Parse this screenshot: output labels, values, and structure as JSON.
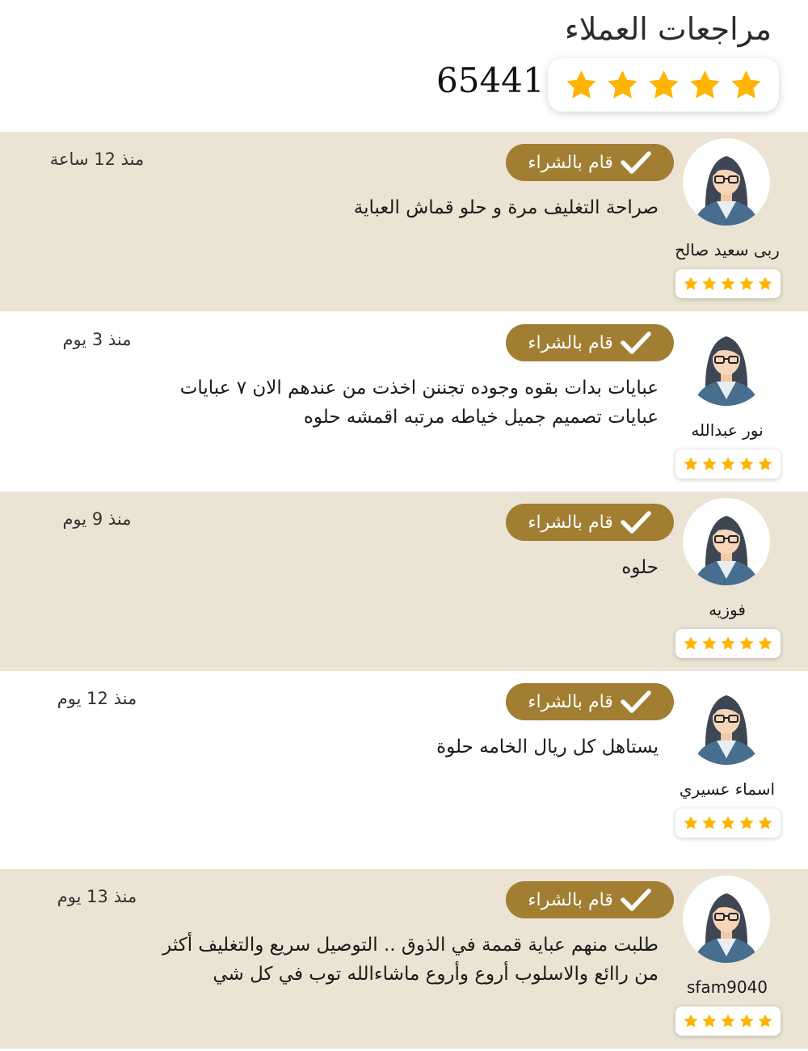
{
  "header": {
    "title": "مراجعات العملاء",
    "total_count": "65441",
    "average_stars": 5
  },
  "colors": {
    "shaded_row": "#ebe3d3",
    "badge": "#a27e33",
    "star": "#ffb400"
  },
  "reviews": [
    {
      "name": "ربى سعيد صالح",
      "badge": "قام بالشراء",
      "time": "منذ 12 ساعة",
      "lines": [
        "صراحة التغليف مرة و حلو قماش العباية"
      ],
      "stars": 5,
      "shaded": true
    },
    {
      "name": "نور عبدالله",
      "badge": "قام بالشراء",
      "time": "منذ 3 يوم",
      "lines": [
        "عبايات بدات بقوه وجوده تجننن اخذت من عندهم الان ٧ عبايات",
        "عبايات تصميم جميل خياطه مرتبه اقمشه حلوه"
      ],
      "stars": 5,
      "shaded": false
    },
    {
      "name": "فوزيه",
      "badge": "قام بالشراء",
      "time": "منذ 9 يوم",
      "lines": [
        "حلوه"
      ],
      "stars": 5,
      "shaded": true
    },
    {
      "name": "اسماء عسيري",
      "badge": "قام بالشراء",
      "time": "منذ 12 يوم",
      "lines": [
        "يستاهل كل ريال الخامه حلوة"
      ],
      "stars": 5,
      "shaded": false
    },
    {
      "name": "sfam9040",
      "badge": "قام بالشراء",
      "time": "منذ 13 يوم",
      "lines": [
        "طلبت منهم عباية قممة في الذوق .. التوصيل سريع والتغليف أكثر",
        "من راائع والاسلوب أروع وأروع ماشاءالله توب في كل شي"
      ],
      "stars": 5,
      "shaded": true
    }
  ]
}
